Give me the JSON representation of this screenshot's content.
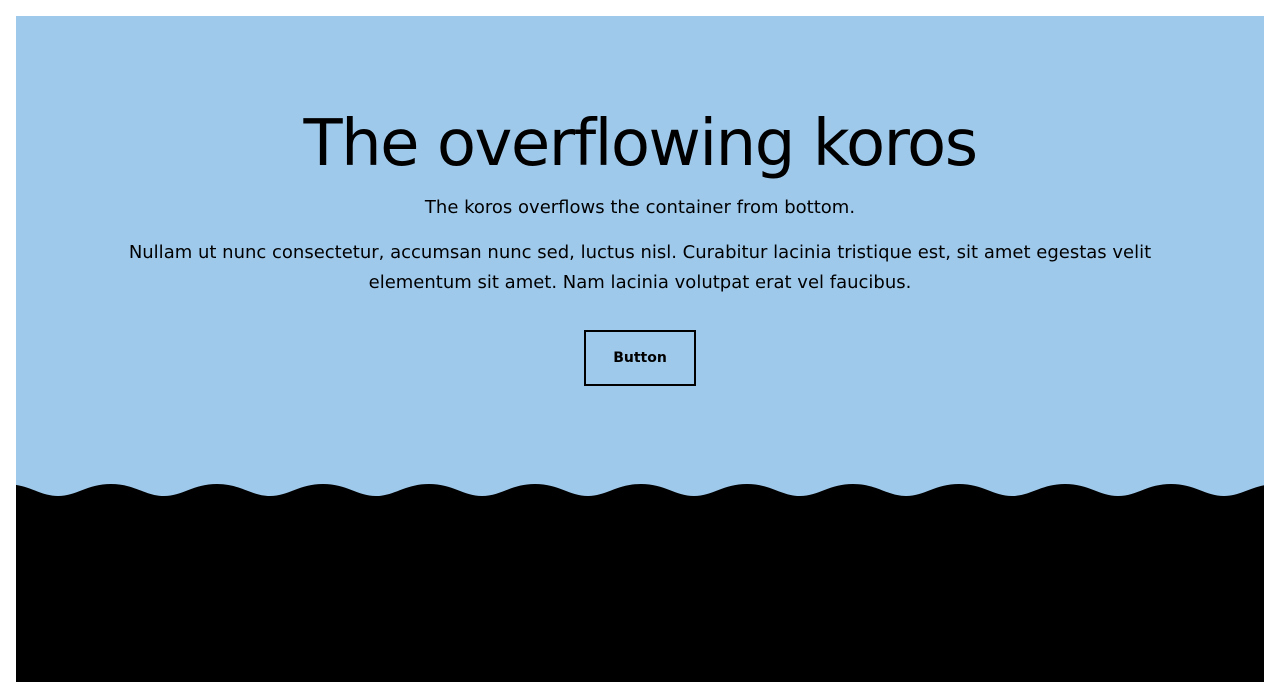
{
  "hero": {
    "title": "The overflowing koros",
    "subtitle": "The koros overflows the container from bottom.",
    "body": "Nullam ut nunc consectetur, accumsan nunc sed, luctus nisl. Curabitur lacinia tristique est, sit amet egestas velit elementum sit amet. Nam lacinia volutpat erat vel faucibus.",
    "button_label": "Button"
  },
  "colors": {
    "background": "#9fc9eb",
    "koros": "#000000",
    "text": "#000000",
    "page": "#ffffff"
  },
  "decor": {
    "koros_shape": "wave"
  }
}
